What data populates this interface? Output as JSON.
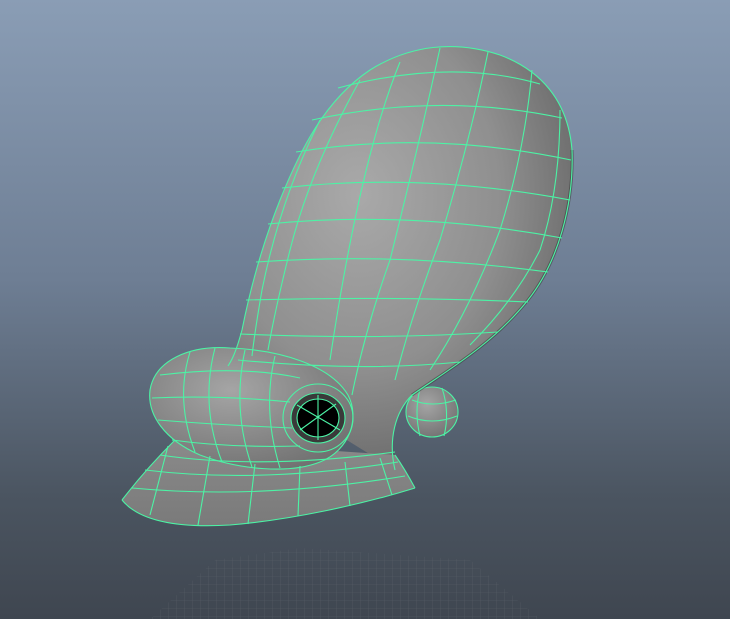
{
  "viewport": {
    "background_top": "#8a9db5",
    "background_bottom": "#3f4650"
  },
  "model": {
    "surface_color": "#8c8c8c",
    "wireframe_color": "#4cf3a5",
    "hole_color": "#000000",
    "selection_state": "selected"
  },
  "ground_grid": {
    "visible": true,
    "color": "#666b72"
  }
}
